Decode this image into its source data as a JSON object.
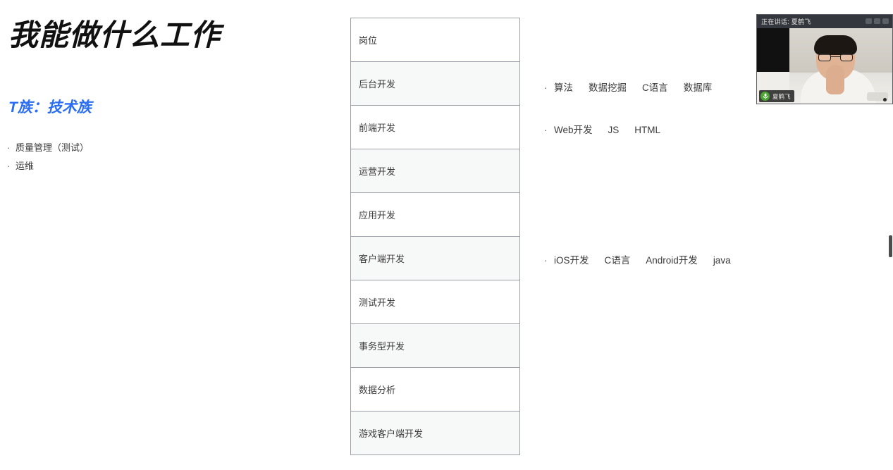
{
  "slide": {
    "title": "我能做什么工作",
    "family_heading": "T族：技术族",
    "left_bullets": [
      {
        "dot": "·",
        "text": "质量管理（测试）"
      },
      {
        "dot": "·",
        "text": "运维"
      }
    ]
  },
  "jobs_table": {
    "header": "岗位",
    "rows": [
      {
        "label": "后台开发",
        "shaded": true
      },
      {
        "label": "前端开发",
        "shaded": false
      },
      {
        "label": "运营开发",
        "shaded": true
      },
      {
        "label": "应用开发",
        "shaded": false
      },
      {
        "label": "客户端开发",
        "shaded": true
      },
      {
        "label": "测试开发",
        "shaded": false
      },
      {
        "label": "事务型开发",
        "shaded": true
      },
      {
        "label": "数据分析",
        "shaded": false
      },
      {
        "label": "游戏客户端开发",
        "shaded": true
      }
    ]
  },
  "skill_notes": [
    {
      "dot": "·",
      "tokens": [
        "算法",
        "数据挖掘",
        "C语言",
        "数据库"
      ]
    },
    {
      "dot": "·",
      "tokens": [
        "Web开发",
        "JS",
        "HTML"
      ]
    },
    {
      "dot": "·",
      "tokens": [
        "iOS开发",
        "C语言",
        "Android开发",
        "java"
      ]
    }
  ],
  "video_overlay": {
    "speaking_label": "正在讲话: 夏鹤飞",
    "speaker_name": "夏鹤飞",
    "mic_icon": "microphone-icon"
  },
  "colors": {
    "accent_blue": "#2a6df4",
    "title_black": "#111111",
    "table_border": "#9aa0a6",
    "row_shaded": "#f7f8f8",
    "overlay_bg": "#2f3136",
    "mic_green": "#4aa832"
  }
}
